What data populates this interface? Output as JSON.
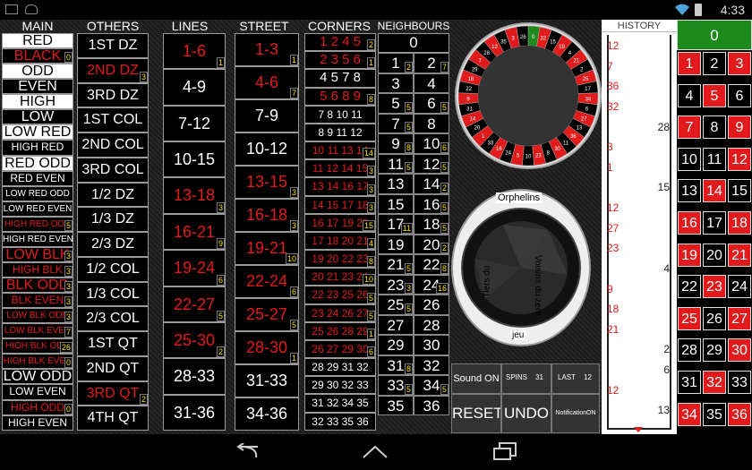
{
  "status_bar": {
    "time": "4:33"
  },
  "headers": {
    "main": "MAIN",
    "others": "OTHERS",
    "lines": "LINES",
    "street": "STREET",
    "corners": "CORNERS",
    "neighbours": "NEIGHBOURS",
    "history": "HISTORY"
  },
  "main_buttons": [
    {
      "label": "RED",
      "red": false
    },
    {
      "label": "BLACK",
      "red": true,
      "badge": "0"
    },
    {
      "label": "ODD",
      "red": false
    },
    {
      "label": "EVEN",
      "red": false
    },
    {
      "label": "HIGH",
      "red": false
    },
    {
      "label": "LOW",
      "red": false
    },
    {
      "label": "LOW RED",
      "red": false
    },
    {
      "label": "HIGH RED",
      "red": false
    },
    {
      "label": "RED ODD",
      "red": false
    },
    {
      "label": "RED EVEN",
      "red": false
    },
    {
      "label": "LOW RED ODD",
      "red": false
    },
    {
      "label": "LOW RED EVEN",
      "red": false
    },
    {
      "label": "HIGH RED ODD",
      "red": true,
      "badge": "5"
    },
    {
      "label": "HIGH RED EVEN",
      "red": false
    },
    {
      "label": "LOW BLK",
      "red": true,
      "badge": "3"
    },
    {
      "label": "HIGH BLK",
      "red": true,
      "badge": "3"
    },
    {
      "label": "BLK ODD",
      "red": true,
      "badge": "3"
    },
    {
      "label": "BLK EVEN",
      "red": true,
      "badge": "3"
    },
    {
      "label": "LOW BLK ODD",
      "red": true,
      "badge": "3"
    },
    {
      "label": "LOW BLK EVEN",
      "red": true,
      "badge": "7"
    },
    {
      "label": "HIGH BLK ODD",
      "red": true,
      "badge": "26"
    },
    {
      "label": "HIGH BLK EVEN",
      "red": true,
      "badge": "0"
    },
    {
      "label": "LOW ODD",
      "red": false
    },
    {
      "label": "LOW EVEN",
      "red": false
    },
    {
      "label": "HIGH ODD",
      "red": true,
      "badge": "0"
    },
    {
      "label": "HIGH EVEN",
      "red": false
    }
  ],
  "others_buttons": [
    {
      "label": "1ST DZ",
      "red": false
    },
    {
      "label": "2ND DZ",
      "red": true,
      "badge": "3"
    },
    {
      "label": "3RD DZ",
      "red": false
    },
    {
      "label": "1ST COL",
      "red": false
    },
    {
      "label": "2ND COL",
      "red": false
    },
    {
      "label": "3RD COL",
      "red": false
    },
    {
      "label": "1/2 DZ",
      "red": false
    },
    {
      "label": "1/3 DZ",
      "red": false
    },
    {
      "label": "2/3 DZ",
      "red": false
    },
    {
      "label": "1/2 COL",
      "red": false
    },
    {
      "label": "1/3 COL",
      "red": false
    },
    {
      "label": "2/3 COL",
      "red": false
    },
    {
      "label": "1ST QT",
      "red": false
    },
    {
      "label": "2ND QT",
      "red": false
    },
    {
      "label": "3RD QT",
      "red": true,
      "badge": "2"
    },
    {
      "label": "4TH QT",
      "red": false
    }
  ],
  "lines_buttons": [
    {
      "label": "1-6",
      "red": true,
      "badge": "1"
    },
    {
      "label": "4-9",
      "red": false
    },
    {
      "label": "7-12",
      "red": false
    },
    {
      "label": "10-15",
      "red": false
    },
    {
      "label": "13-18",
      "red": true,
      "badge": "3"
    },
    {
      "label": "16-21",
      "red": true,
      "badge": "9"
    },
    {
      "label": "19-24",
      "red": true,
      "badge": "6"
    },
    {
      "label": "22-27",
      "red": true,
      "badge": "5"
    },
    {
      "label": "25-30",
      "red": true,
      "badge": "2"
    },
    {
      "label": "28-33",
      "red": false
    },
    {
      "label": "31-36",
      "red": false
    }
  ],
  "street_buttons": [
    {
      "label": "1-3",
      "red": true,
      "badge": "1"
    },
    {
      "label": "4-6",
      "red": true,
      "badge": "7"
    },
    {
      "label": "7-9",
      "red": false
    },
    {
      "label": "10-12",
      "red": false
    },
    {
      "label": "13-15",
      "red": true,
      "badge": "3"
    },
    {
      "label": "16-18",
      "red": true,
      "badge": "3"
    },
    {
      "label": "19-21",
      "red": true,
      "badge": "10"
    },
    {
      "label": "22-24",
      "red": true,
      "badge": "6"
    },
    {
      "label": "25-27",
      "red": true,
      "badge": "5"
    },
    {
      "label": "28-30",
      "red": true,
      "badge": "1"
    },
    {
      "label": "31-33",
      "red": false
    },
    {
      "label": "34-36",
      "red": false
    }
  ],
  "corners_buttons": [
    {
      "label": "1 2 4 5",
      "red": true,
      "badge": "2"
    },
    {
      "label": "2 3 5 6",
      "red": true,
      "badge": "1"
    },
    {
      "label": "4 5 7 8",
      "red": false
    },
    {
      "label": "5 6 8 9",
      "red": true,
      "badge": "8"
    },
    {
      "label": "7 8 10 11",
      "red": false
    },
    {
      "label": "8 9 11 12",
      "red": false
    },
    {
      "label": "10 11 13 14",
      "red": true,
      "badge": "14"
    },
    {
      "label": "11 12 14 15",
      "red": true,
      "badge": "3"
    },
    {
      "label": "13 14 16 17",
      "red": true,
      "badge": "3"
    },
    {
      "label": "14 15 17 18",
      "red": true,
      "badge": "3"
    },
    {
      "label": "16 17 19 20",
      "red": true,
      "badge": "15"
    },
    {
      "label": "17 18 20 21",
      "red": true,
      "badge": "4"
    },
    {
      "label": "19 20 22 23",
      "red": true,
      "badge": "8"
    },
    {
      "label": "20 21 23 24",
      "red": true,
      "badge": "10"
    },
    {
      "label": "22 23 25 26",
      "red": true,
      "badge": "5"
    },
    {
      "label": "23 24 26 27",
      "red": true,
      "badge": "5"
    },
    {
      "label": "25 26 28 29",
      "red": true,
      "badge": "1"
    },
    {
      "label": "26 27 29 30",
      "red": true,
      "badge": "6"
    },
    {
      "label": "28 29 31 32",
      "red": false
    },
    {
      "label": "29 30 32 33",
      "red": false
    },
    {
      "label": "31 32 34 35",
      "red": false
    },
    {
      "label": "32 33 35 36",
      "red": false
    }
  ],
  "neighbours_zero": "0",
  "neighbours_grid": [
    {
      "n": "1",
      "red": false,
      "badge": "2"
    },
    {
      "n": "2",
      "red": true,
      "badge": "7"
    },
    {
      "n": "3",
      "red": false
    },
    {
      "n": "4",
      "red": false
    },
    {
      "n": "5",
      "red": false,
      "badge": "5"
    },
    {
      "n": "6",
      "red": true,
      "badge": "5"
    },
    {
      "n": "7",
      "red": false,
      "badge": "5"
    },
    {
      "n": "8",
      "red": false
    },
    {
      "n": "9",
      "red": true,
      "badge": "8"
    },
    {
      "n": "10",
      "red": true,
      "badge": "6"
    },
    {
      "n": "11",
      "red": false,
      "badge": "5"
    },
    {
      "n": "12",
      "red": false,
      "badge": "5"
    },
    {
      "n": "13",
      "red": false
    },
    {
      "n": "14",
      "red": true,
      "badge": "2"
    },
    {
      "n": "15",
      "red": false
    },
    {
      "n": "16",
      "red": true,
      "badge": "5"
    },
    {
      "n": "17",
      "red": true,
      "badge": "11"
    },
    {
      "n": "18",
      "red": false,
      "badge": "5"
    },
    {
      "n": "19",
      "red": false
    },
    {
      "n": "20",
      "red": true,
      "badge": "2"
    },
    {
      "n": "21",
      "red": true,
      "badge": "5"
    },
    {
      "n": "22",
      "red": true,
      "badge": "8"
    },
    {
      "n": "23",
      "red": false,
      "badge": "3"
    },
    {
      "n": "24",
      "red": false,
      "badge": "16"
    },
    {
      "n": "25",
      "red": true,
      "badge": "5"
    },
    {
      "n": "26",
      "red": false
    },
    {
      "n": "27",
      "red": false
    },
    {
      "n": "28",
      "red": false
    },
    {
      "n": "29",
      "red": false
    },
    {
      "n": "30",
      "red": false
    },
    {
      "n": "31",
      "red": true,
      "badge": "8"
    },
    {
      "n": "32",
      "red": false
    },
    {
      "n": "33",
      "red": false,
      "badge": "5"
    },
    {
      "n": "34",
      "red": true,
      "badge": "5"
    },
    {
      "n": "35",
      "red": false
    },
    {
      "n": "36",
      "red": false
    }
  ],
  "sector_labels": {
    "orphelins": "Orphelins",
    "voisins": "Voisins du zero",
    "tiers": "Tiers du",
    "jeu": "jeu"
  },
  "wheel_numbers": [
    "0",
    "32",
    "15",
    "19",
    "4",
    "21",
    "2",
    "25",
    "17",
    "34",
    "6",
    "27",
    "13",
    "36",
    "11",
    "30",
    "8",
    "23",
    "10",
    "5",
    "24",
    "16",
    "33",
    "1",
    "20",
    "14",
    "31",
    "9",
    "22",
    "18",
    "29",
    "7",
    "28",
    "12",
    "35",
    "3",
    "26"
  ],
  "controls": {
    "sound": "Sound ON",
    "spins_label": "SPINS",
    "spins_value": "31",
    "last_label": "LAST",
    "last_value": "12",
    "reset": "RESET",
    "undo": "UNDO",
    "notification": "NotificationON"
  },
  "history": [
    {
      "n": "12",
      "red": true,
      "side": "left"
    },
    {
      "n": "7",
      "red": true,
      "side": "left"
    },
    {
      "n": "36",
      "red": true,
      "side": "left"
    },
    {
      "n": "32",
      "red": true,
      "side": "left"
    },
    {
      "n": "28",
      "red": false,
      "side": "right"
    },
    {
      "n": "3",
      "red": true,
      "side": "left"
    },
    {
      "n": "1",
      "red": true,
      "side": "left"
    },
    {
      "n": "15",
      "red": false,
      "side": "right"
    },
    {
      "n": "12",
      "red": true,
      "side": "left"
    },
    {
      "n": "27",
      "red": true,
      "side": "left"
    },
    {
      "n": "23",
      "red": true,
      "side": "left"
    },
    {
      "n": "4",
      "red": false,
      "side": "right"
    },
    {
      "n": "9",
      "red": true,
      "side": "left"
    },
    {
      "n": "18",
      "red": true,
      "side": "left"
    },
    {
      "n": "21",
      "red": true,
      "side": "left"
    },
    {
      "n": "2",
      "red": false,
      "side": "right"
    },
    {
      "n": "6",
      "red": false,
      "side": "right"
    },
    {
      "n": "12",
      "red": true,
      "side": "left"
    },
    {
      "n": "13",
      "red": false,
      "side": "right"
    }
  ],
  "board_zero": "0",
  "board": [
    {
      "n": "1",
      "red": true
    },
    {
      "n": "2",
      "red": false
    },
    {
      "n": "3",
      "red": true
    },
    {
      "n": "4",
      "red": false
    },
    {
      "n": "5",
      "red": true
    },
    {
      "n": "6",
      "red": false
    },
    {
      "n": "7",
      "red": true
    },
    {
      "n": "8",
      "red": false
    },
    {
      "n": "9",
      "red": true
    },
    {
      "n": "10",
      "red": false
    },
    {
      "n": "11",
      "red": false
    },
    {
      "n": "12",
      "red": true
    },
    {
      "n": "13",
      "red": false
    },
    {
      "n": "14",
      "red": true
    },
    {
      "n": "15",
      "red": false
    },
    {
      "n": "16",
      "red": true
    },
    {
      "n": "17",
      "red": false
    },
    {
      "n": "18",
      "red": true
    },
    {
      "n": "19",
      "red": true
    },
    {
      "n": "20",
      "red": false
    },
    {
      "n": "21",
      "red": true
    },
    {
      "n": "22",
      "red": false
    },
    {
      "n": "23",
      "red": true
    },
    {
      "n": "24",
      "red": false
    },
    {
      "n": "25",
      "red": true
    },
    {
      "n": "26",
      "red": false
    },
    {
      "n": "27",
      "red": true
    },
    {
      "n": "28",
      "red": false
    },
    {
      "n": "29",
      "red": false
    },
    {
      "n": "30",
      "red": true
    },
    {
      "n": "31",
      "red": false
    },
    {
      "n": "32",
      "red": true
    },
    {
      "n": "33",
      "red": false
    },
    {
      "n": "34",
      "red": true
    },
    {
      "n": "35",
      "red": false
    },
    {
      "n": "36",
      "red": true
    }
  ],
  "colors": {
    "red": "#e11b1b",
    "green": "#1e8a1e",
    "badge": "#ffe600"
  }
}
